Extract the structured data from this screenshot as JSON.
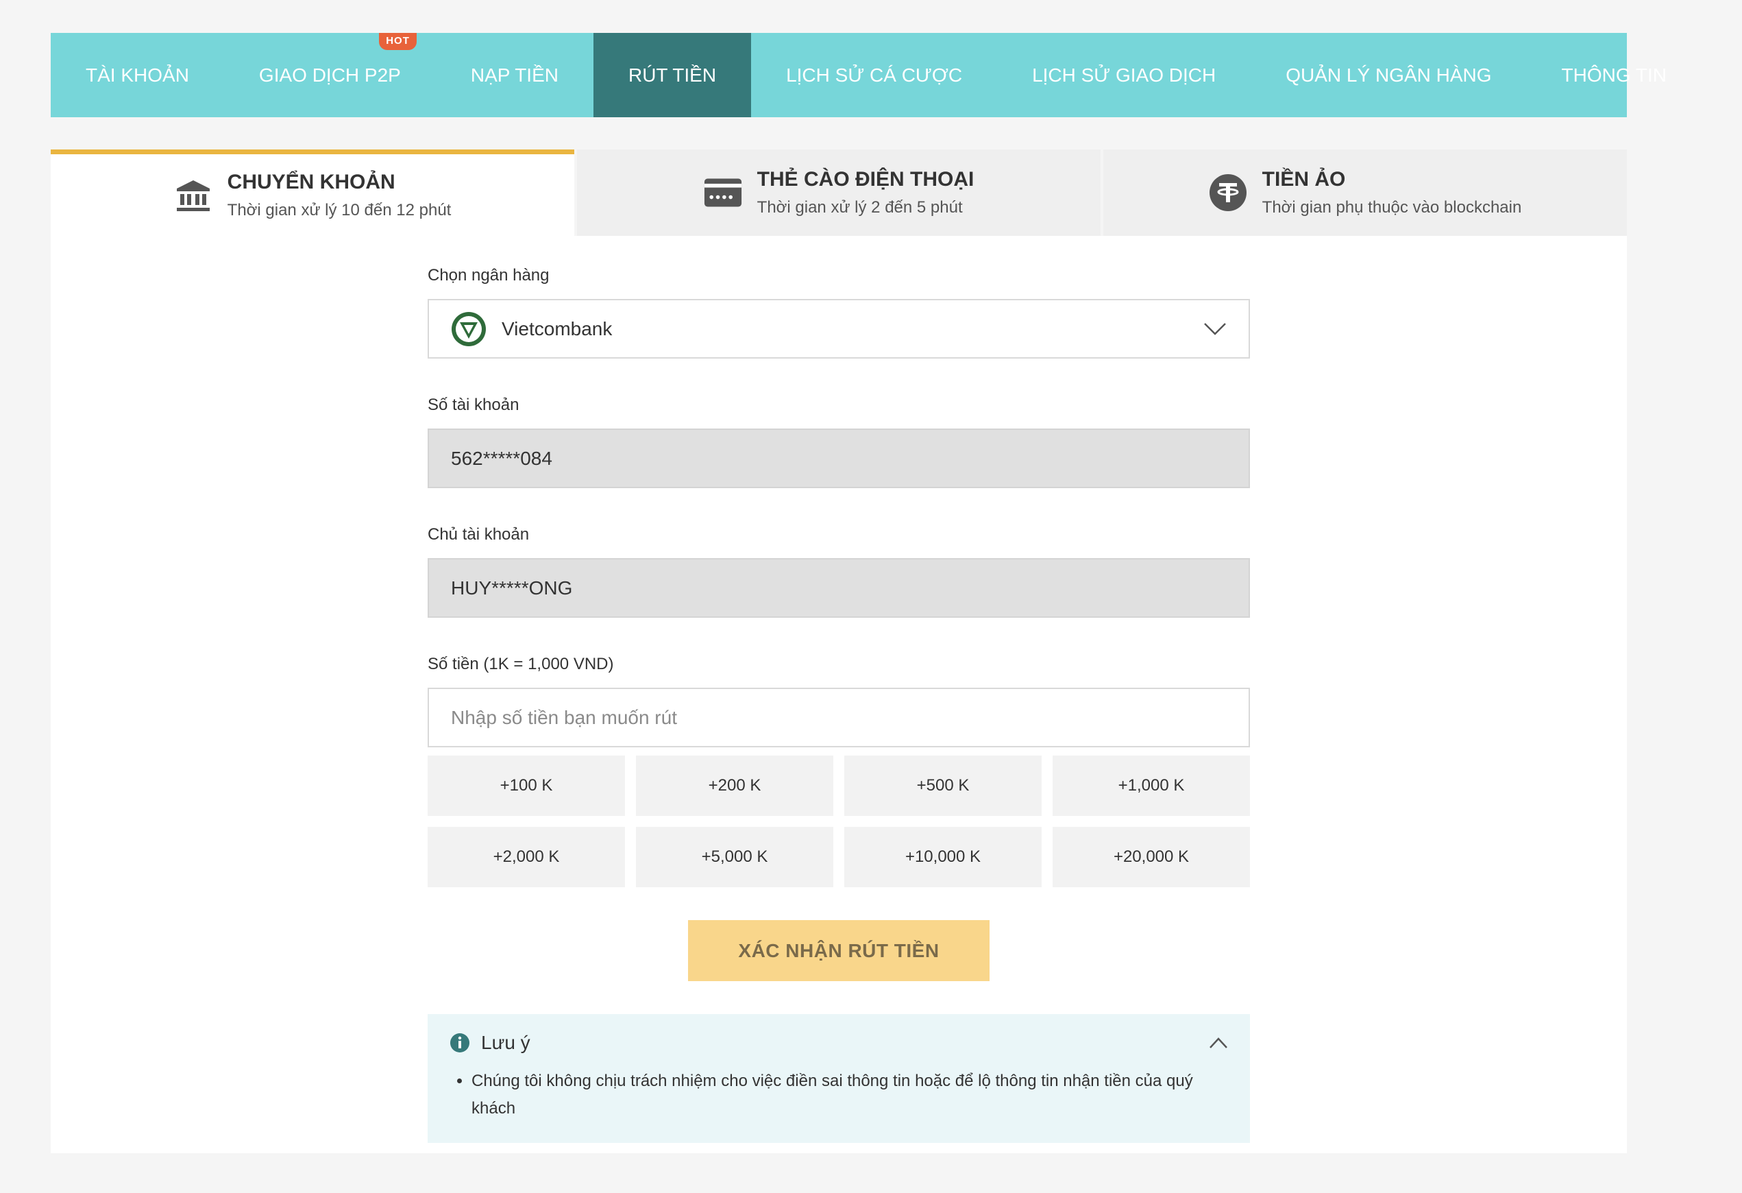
{
  "nav": {
    "items": [
      {
        "label": "TÀI KHOẢN"
      },
      {
        "label": "GIAO DỊCH P2P",
        "badge": "HOT"
      },
      {
        "label": "NẠP TIỀN"
      },
      {
        "label": "RÚT TIỀN",
        "active": true
      },
      {
        "label": "LỊCH SỬ CÁ CƯỢC"
      },
      {
        "label": "LỊCH SỬ GIAO DỊCH"
      },
      {
        "label": "QUẢN LÝ NGÂN HÀNG"
      },
      {
        "label": "THÔNG TIN"
      }
    ]
  },
  "methods": [
    {
      "title": "CHUYỂN KHOẢN",
      "subtitle": "Thời gian xử lý 10 đến 12 phút",
      "icon": "bank-icon",
      "active": true
    },
    {
      "title": "THẺ CÀO ĐIỆN THOẠI",
      "subtitle": "Thời gian xử lý 2 đến 5 phút",
      "icon": "card-icon"
    },
    {
      "title": "TIỀN ẢO",
      "subtitle": "Thời gian phụ thuộc vào blockchain",
      "icon": "tether-icon"
    }
  ],
  "form": {
    "bank_label": "Chọn ngân hàng",
    "bank_value": "Vietcombank",
    "account_number_label": "Số tài khoản",
    "account_number_value": "562*****084",
    "account_holder_label": "Chủ tài khoản",
    "account_holder_value": "HUY*****ONG",
    "amount_label": "Số tiền (1K = 1,000 VND)",
    "amount_placeholder": "Nhập số tiền bạn muốn rút",
    "quick_amounts": [
      "+100 K",
      "+200 K",
      "+500 K",
      "+1,000 K",
      "+2,000 K",
      "+5,000 K",
      "+10,000 K",
      "+20,000 K"
    ],
    "submit_label": "XÁC NHẬN RÚT TIỀN"
  },
  "note": {
    "title": "Lưu ý",
    "items": [
      "Chúng tôi không chịu trách nhiệm cho việc điền sai thông tin hoặc để lộ thông tin nhận tiền của quý khách"
    ]
  },
  "colors": {
    "nav_bg": "#77d6d9",
    "nav_active": "#36797a",
    "accent": "#eab540",
    "submit_bg": "#f9d68b",
    "hot_badge": "#e8623a",
    "note_bg": "#eaf6f8"
  }
}
